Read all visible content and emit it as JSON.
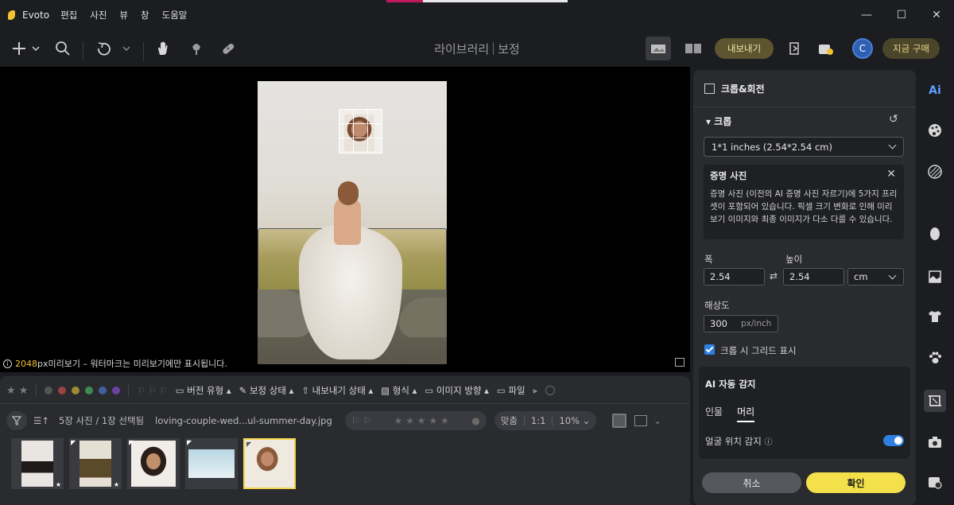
{
  "app": {
    "name": "Evoto"
  },
  "menu": [
    "편집",
    "사진",
    "뷰",
    "창",
    "도움말"
  ],
  "window_controls": {
    "minimize": "—",
    "maximize": "☐",
    "close": "✕"
  },
  "header": {
    "title_left": "라이브러리",
    "title_right": "보정",
    "export_label": "내보내기",
    "buy_label": "지금 구매",
    "avatar_initial": "C"
  },
  "canvas": {
    "preview_px": "2048",
    "preview_unit": "px",
    "preview_note": " 미리보기 – 워터마크는 미리보기에만 표시됩니다."
  },
  "filmstrip": {
    "filters": {
      "version_type": "버전 유형",
      "edit_status": "보정 상태",
      "export_status": "내보내기 상태",
      "format": "형식",
      "orientation": "이미지 방향",
      "file": "파일"
    },
    "color_dots": [
      "#555555",
      "#b04a4a",
      "#b49a3a",
      "#4a9a5a",
      "#4a6ab0",
      "#7a4ab0"
    ],
    "count_label": "5장 사진 / 1장 선택됨",
    "filename": "loving-couple-wed...ul-summer-day.jpg",
    "fit_label": "맞춤",
    "ratio_label": "1:1",
    "zoom": "10%",
    "thumbnails": [
      {
        "colors": [
          "#e9e6e2",
          "#1e1a18"
        ],
        "badge": "★"
      },
      {
        "colors": [
          "#e6dfd4",
          "#5a4a2a"
        ],
        "badge": "★"
      },
      {
        "colors": [
          "#f0ece8",
          "#3a2a22"
        ],
        "badge": ""
      },
      {
        "colors": [
          "#b8d6e2",
          "#e6f0f4"
        ],
        "badge": ""
      },
      {
        "colors": [
          "#efe9e0",
          "#8a5a3a"
        ],
        "badge": "",
        "selected": true
      }
    ]
  },
  "panel": {
    "title": "크롭&회전",
    "crop_section": "크롭",
    "preset": "1*1 inches (2.54*2.54 cm)",
    "info_title": "증명 사진",
    "info_text": "증명 사진 (이전의 AI 증명 사진 자르기)에 5가지 프리셋이 포함되어 있습니다. 픽셀 크기 변화로 인해 미리보기 이미지와 최종 이미지가 다소 다를 수 있습니다.",
    "width_label": "폭",
    "height_label": "높이",
    "width_value": "2.54",
    "height_value": "2.54",
    "unit": "cm",
    "resolution_label": "해상도",
    "resolution_value": "300",
    "resolution_unit": "px/inch",
    "grid_label": "크롭 시 그리드 표시",
    "ai_title": "AI 자동 감지",
    "tab_person": "인물",
    "tab_head": "머리",
    "face_label": "얼굴 위치 감지",
    "cancel_label": "취소",
    "ok_label": "확인"
  }
}
